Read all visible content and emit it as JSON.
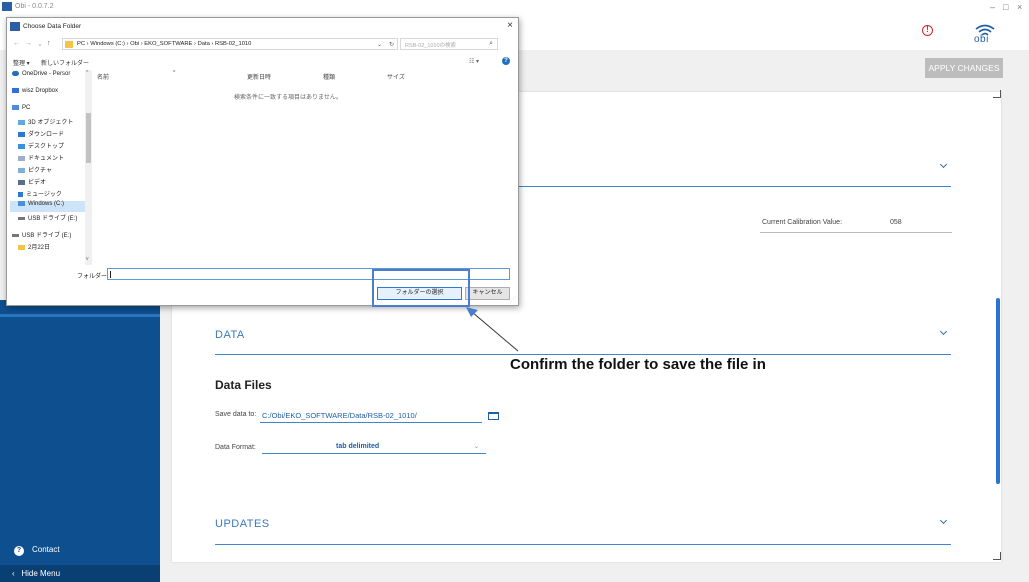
{
  "app": {
    "title": "Obi - 0.0.7.2",
    "logo": "obi"
  },
  "window_controls": {
    "minimize": "–",
    "maximize": "□",
    "close": "×"
  },
  "apply_button": "APPLY CHANGES",
  "sections": {
    "data": {
      "title": "DATA"
    },
    "updates": {
      "title": "UPDATES"
    }
  },
  "calibration": {
    "label": "Current Calibration Value:",
    "value": "058"
  },
  "data_files": {
    "heading": "Data Files",
    "save_label": "Save data to:",
    "save_path": "C:/Obi/EKO_SOFTWARE/Data/RSB-02_1010/",
    "format_label": "Data Format:",
    "format_value": "tab delimited"
  },
  "sidebar": {
    "contact": "Contact",
    "hide_menu": "Hide Menu"
  },
  "annotation": "Confirm the folder to save the file in",
  "dialog": {
    "title": "Choose Data Folder",
    "close": "×",
    "path": "PC  ›  Windows (C:)  ›  Obi  ›  EKO_SOFTWARE  ›  Data  ›  RSB-02_1010",
    "search_placeholder": "RSB-02_1010の検索",
    "organize": "整理 ▾",
    "new_folder": "新しいフォルダー",
    "nav_items": [
      "OneDrive - Persor",
      "wisz Dropbox",
      "PC",
      "3D オブジェクト",
      "ダウンロード",
      "デスクトップ",
      "ドキュメント",
      "ピクチャ",
      "ビデオ",
      "ミュージック",
      "Windows (C:)",
      "USB ドライブ (E:)",
      "USB ドライブ (E:)",
      "2月22日"
    ],
    "columns": [
      "名前",
      "更新日時",
      "種類",
      "サイズ"
    ],
    "empty_message": "検索条件に一致する項目はありません。",
    "folder_label": "フォルダー:",
    "select_button": "フォルダーの選択",
    "cancel_button": "キャンセル"
  },
  "colors": {
    "accent": "#1f5fa5",
    "sidebar": "#0e4f8f",
    "highlight": "#4a7cd0",
    "alert": "#d3262b"
  }
}
